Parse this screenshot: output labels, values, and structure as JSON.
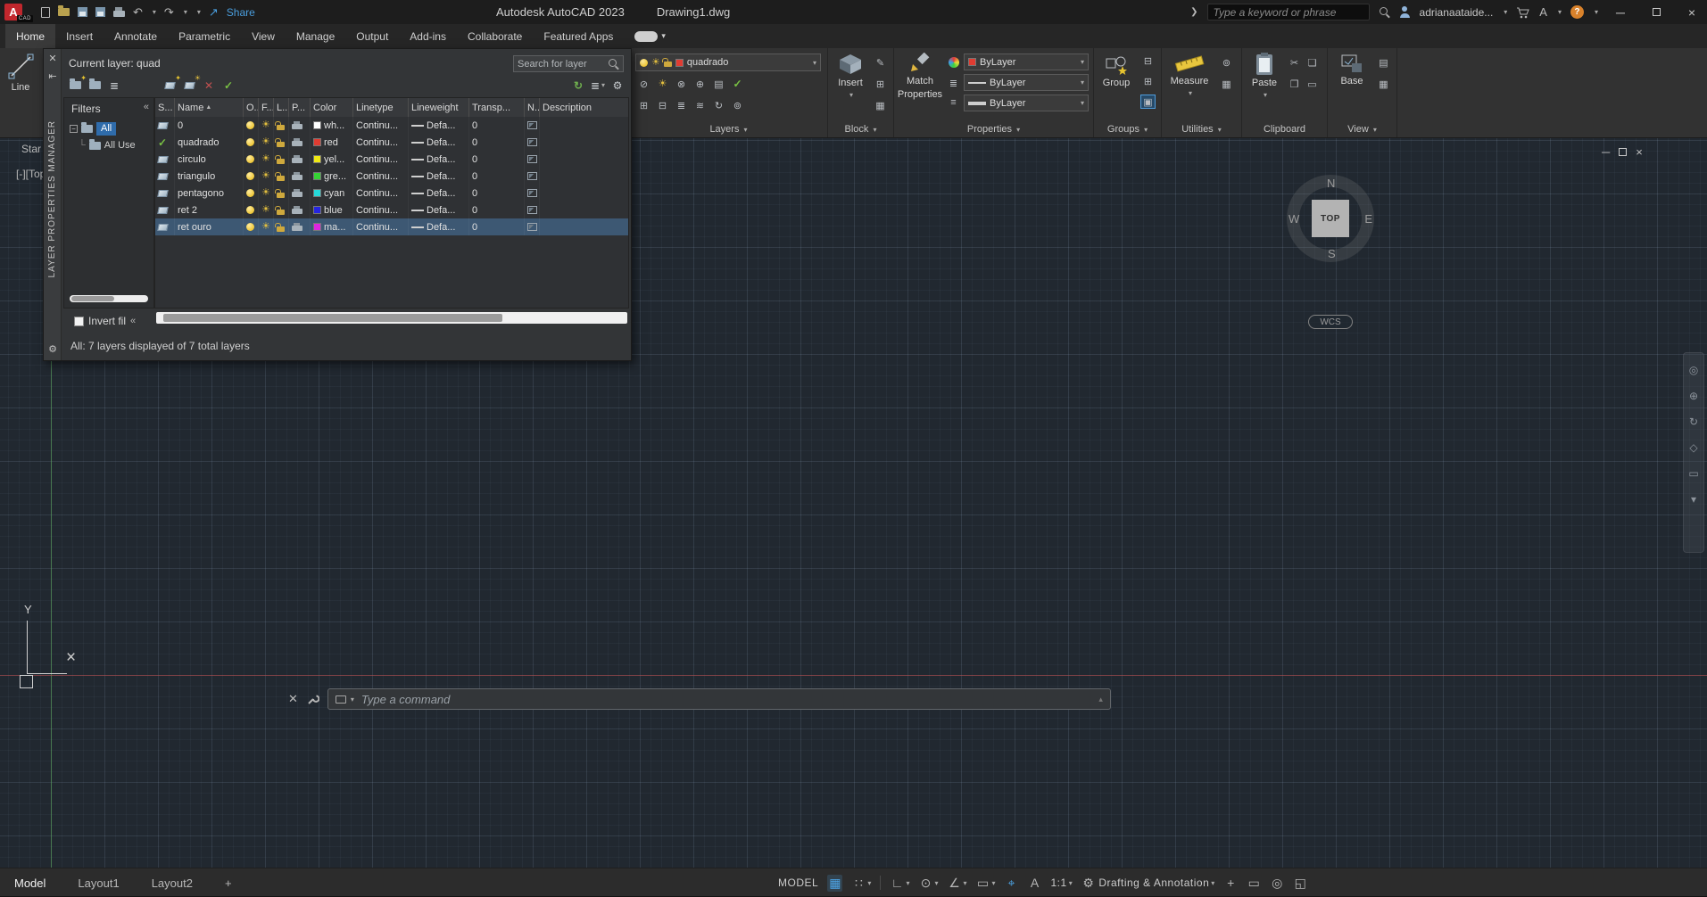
{
  "titlebar": {
    "logo": "A",
    "logo_sub": "CAD",
    "share_label": "Share",
    "app_title": "Autodesk AutoCAD 2023",
    "doc_title": "Drawing1.dwg",
    "search_placeholder": "Type a keyword or phrase",
    "user_name": "adrianaataide...",
    "help_label": "?"
  },
  "ribbon": {
    "tabs": [
      "Home",
      "Insert",
      "Annotate",
      "Parametric",
      "View",
      "Manage",
      "Output",
      "Add-ins",
      "Collaborate",
      "Featured Apps"
    ],
    "active_tab": "Home",
    "line_tool": "Line",
    "layers_panel": {
      "label": "Layers",
      "layer_value": "quadrado",
      "layer_color": "#e03c32"
    },
    "block_panel": {
      "label": "Block",
      "insert_label": "Insert"
    },
    "properties_panel": {
      "label": "Properties",
      "match_label_1": "Match",
      "match_label_2": "Properties",
      "color_value": "ByLayer",
      "color_swatch": "#e03c32",
      "linetype_value": "ByLayer",
      "lineweight_value": "ByLayer"
    },
    "groups_panel": {
      "label": "Groups",
      "group_label": "Group"
    },
    "utilities_panel": {
      "label": "Utilities",
      "measure_label": "Measure"
    },
    "clipboard_panel": {
      "label": "Clipboard",
      "paste_label": "Paste"
    },
    "view_panel": {
      "label": "View",
      "base_label": "Base"
    }
  },
  "palette": {
    "title": "LAYER PROPERTIES MANAGER",
    "current_layer": "Current layer: quad",
    "search_placeholder": "Search for layer",
    "filters_label": "Filters",
    "collapse_glyph": "«",
    "tree_root": "All",
    "tree_child": "All Use",
    "invert_label": "Invert fil",
    "status_text": "All: 7 layers displayed of 7 total layers",
    "columns": {
      "status": "S...",
      "name": "Name",
      "on": "O...",
      "freeze": "F...",
      "lock": "L...",
      "plot": "P...",
      "color": "Color",
      "linetype": "Linetype",
      "lineweight": "Lineweight",
      "transparency": "Transp...",
      "new_vp": "N...",
      "description": "Description"
    },
    "rows": [
      {
        "name": "0",
        "color": "#ffffff",
        "color_label": "wh...",
        "linetype": "Continu...",
        "lineweight": "Defa...",
        "transparency": "0",
        "current": false,
        "selected": false
      },
      {
        "name": "quadrado",
        "color": "#e03c32",
        "color_label": "red",
        "linetype": "Continu...",
        "lineweight": "Defa...",
        "transparency": "0",
        "current": true,
        "selected": false
      },
      {
        "name": "circulo",
        "color": "#f0e814",
        "color_label": "yel...",
        "linetype": "Continu...",
        "lineweight": "Defa...",
        "transparency": "0",
        "current": false,
        "selected": false
      },
      {
        "name": "triangulo",
        "color": "#35d435",
        "color_label": "gre...",
        "linetype": "Continu...",
        "lineweight": "Defa...",
        "transparency": "0",
        "current": false,
        "selected": false
      },
      {
        "name": "pentagono",
        "color": "#25d8d8",
        "color_label": "cyan",
        "linetype": "Continu...",
        "lineweight": "Defa...",
        "transparency": "0",
        "current": false,
        "selected": false
      },
      {
        "name": "ret 2",
        "color": "#2525e0",
        "color_label": "blue",
        "linetype": "Continu...",
        "lineweight": "Defa...",
        "transparency": "0",
        "current": false,
        "selected": false
      },
      {
        "name": "ret ouro",
        "color": "#de25de",
        "color_label": "ma...",
        "linetype": "Continu...",
        "lineweight": "Defa...",
        "transparency": "0",
        "current": false,
        "selected": true
      }
    ]
  },
  "canvas": {
    "start_tab": "Star",
    "viewport_label": "[-][Top]",
    "viewcube": {
      "n": "N",
      "e": "E",
      "s": "S",
      "w": "W",
      "top": "TOP"
    },
    "wcs_label": "WCS",
    "axis_y_label": "Y"
  },
  "command_line": {
    "placeholder": "Type a command"
  },
  "statusbar": {
    "model_tab": "Model",
    "layout1_tab": "Layout1",
    "layout2_tab": "Layout2",
    "add_layout": "+",
    "space_label": "MODEL",
    "scale_label": "1:1",
    "workspace_label": "Drafting & Annotation"
  },
  "colors": {
    "accent_blue": "#4da6e8",
    "selection_row": "#3d5873",
    "canvas_bg": "#212830"
  }
}
